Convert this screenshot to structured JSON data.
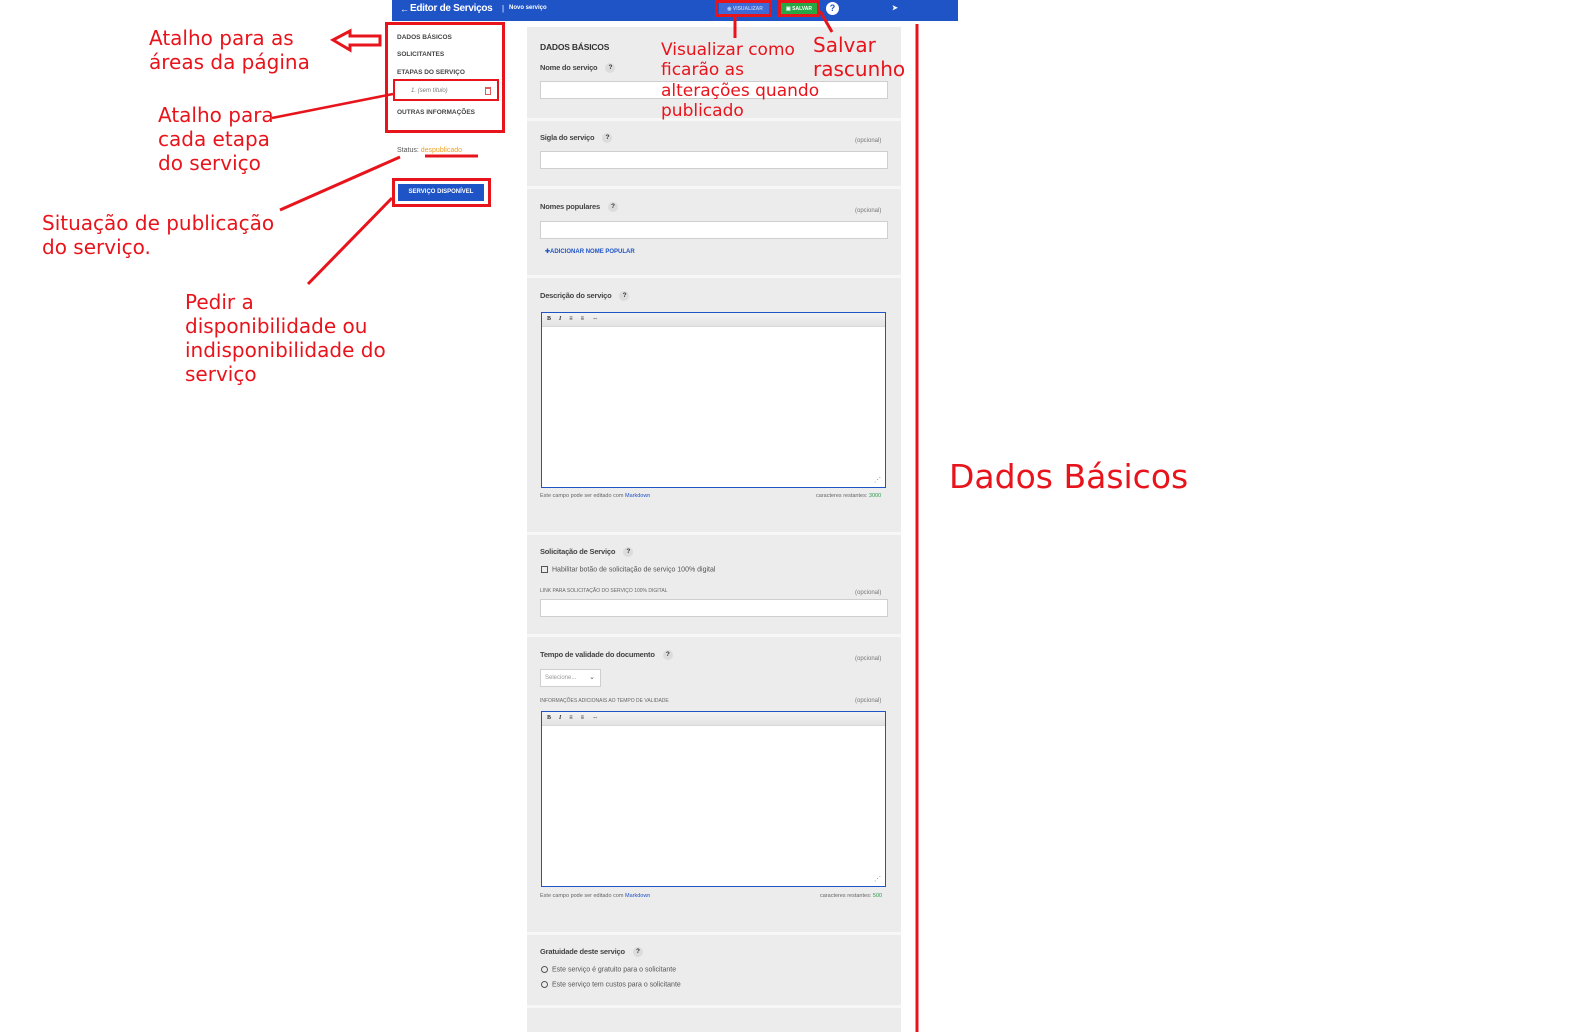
{
  "app": {
    "back_icon": "arrow-left-icon",
    "title": "Editor de Serviços",
    "separator": "|",
    "subtitle": "Novo serviço",
    "visualize_label": "VISUALIZAR",
    "save_label": "SALVAR",
    "help_label": "?",
    "exit_icon": "exit-icon"
  },
  "nav": {
    "items": [
      "DADOS BÁSICOS",
      "SOLICITANTES",
      "ETAPAS DO SERVIÇO",
      "OUTRAS INFORMAÇÕES"
    ],
    "step": "1. (sem título)",
    "status_label": "Status:",
    "status_value": "despublicado",
    "status_color": "#f0a020",
    "avail_button": "SERVIÇO DISPONÍVEL"
  },
  "form": {
    "section_title": "DADOS BÁSICOS",
    "help": "?",
    "optional": "(opcional)",
    "nome_label": "Nome do serviço",
    "sigla_label": "Sigla do serviço",
    "populares_label": "Nomes populares",
    "add_popular": "ADICIONAR NOME POPULAR",
    "descricao_label": "Descrição do serviço",
    "toolbar": [
      "B",
      "I",
      "≡",
      "≡",
      "⇔"
    ],
    "hint_text": "Este campo pode ser editado com",
    "hint_link": "Markdown",
    "remaining_label": "caracteres restantes:",
    "remaining_desc": "3000",
    "solicitacao_label": "Solicitação de Serviço",
    "checkbox_label": "Habilitar botão de solicitação de serviço 100% digital",
    "link_caption": "LINK PARA SOLICITAÇÃO DO SERVIÇO 100% DIGITAL",
    "validade_label": "Tempo de validade do documento",
    "select_value": "Selecione...",
    "info_caption": "INFORMAÇÕES ADICIONAIS AO TEMPO DE VALIDADE",
    "remaining_info": "500",
    "gratuidade_label": "Gratuidade deste serviço",
    "radio_free": "Este serviço é gratuito para o solicitante",
    "radio_cost": "Este serviço tem custos para o solicitante"
  },
  "annotations": {
    "atalho_areas": "Atalho para as áreas da página",
    "atalho_etapa": "Atalho para cada etapa do serviço",
    "situacao": "Situação de publicação do serviço.",
    "pedir": "Pedir a disponibilidade ou indisponibilidade do serviço",
    "visualizar": "Visualizar como ficarão as alterações quando publicado",
    "salvar": "Salvar rascunho",
    "dados_basicos": "Dados Básicos",
    "color": "#e8141c"
  }
}
